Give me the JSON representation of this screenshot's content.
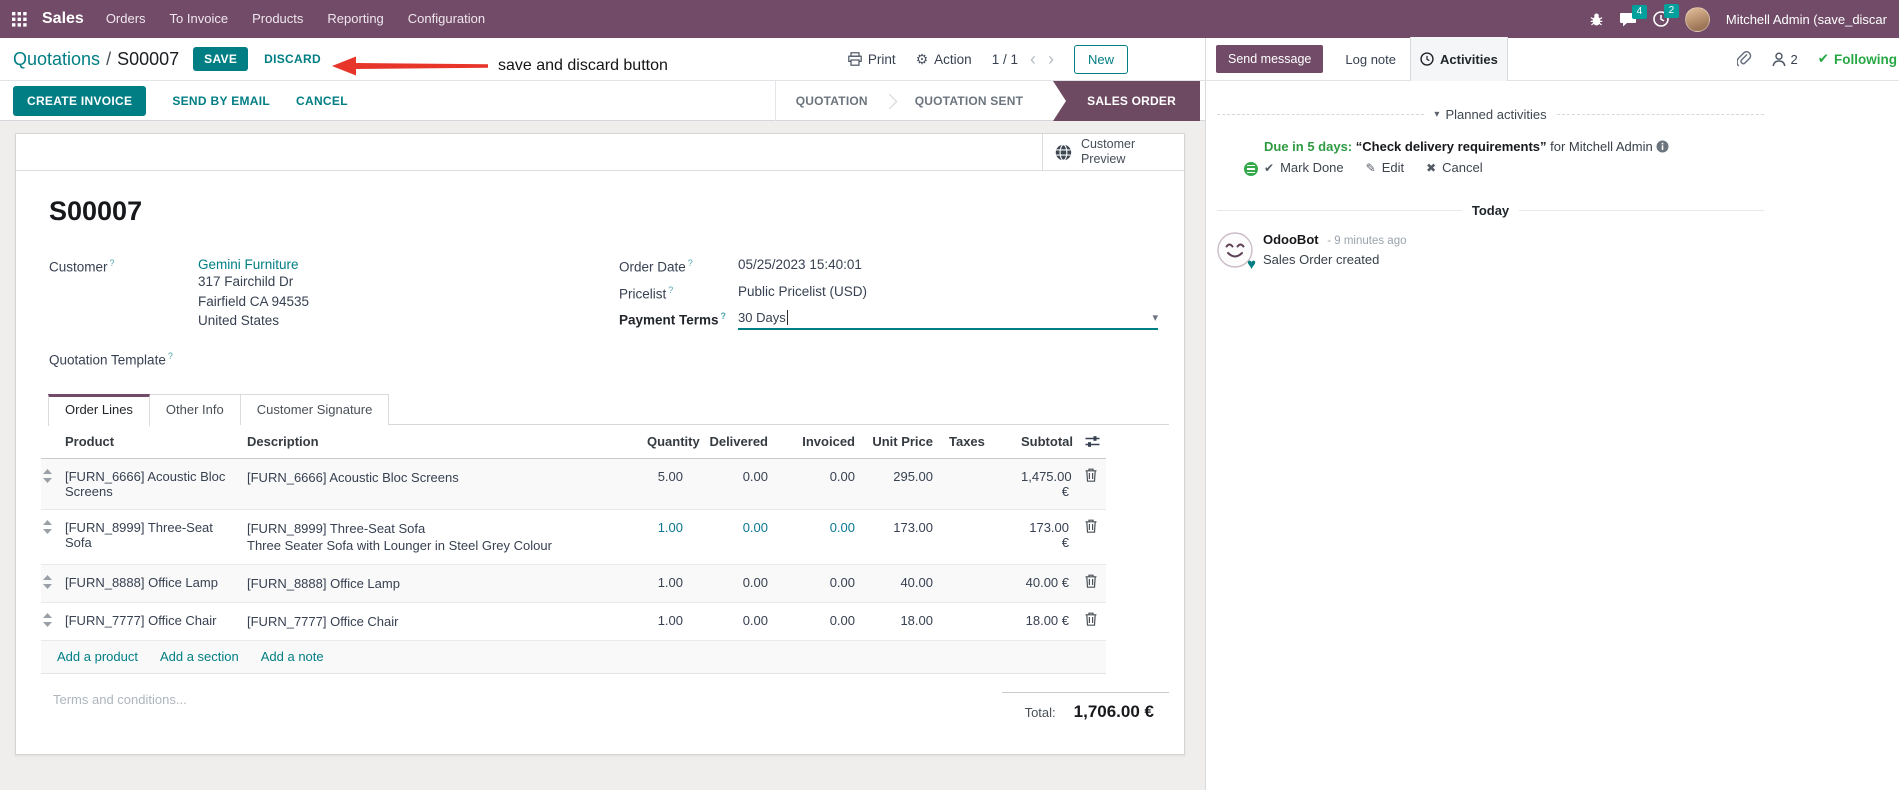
{
  "nav": {
    "app": "Sales",
    "menu": [
      "Orders",
      "To Invoice",
      "Products",
      "Reporting",
      "Configuration"
    ],
    "badge_messages": "4",
    "badge_activities": "2",
    "user": "Mitchell Admin (save_discar"
  },
  "breadcrumb": {
    "parent": "Quotations",
    "separator": "/",
    "current": "S00007",
    "save_label": "SAVE",
    "discard_label": "DISCARD"
  },
  "annotation": {
    "text": "save and discard button"
  },
  "toolbar": {
    "print_label": "Print",
    "action_label": "Action",
    "pager": "1 / 1",
    "new_label": "New"
  },
  "action_buttons": [
    "CREATE INVOICE",
    "SEND BY EMAIL",
    "CANCEL"
  ],
  "statusbar": {
    "steps": [
      "QUOTATION",
      "QUOTATION SENT",
      "SALES ORDER"
    ]
  },
  "form": {
    "reference": "S00007",
    "preview_label": "Customer Preview",
    "help_marker": "?",
    "customer": {
      "label": "Customer",
      "value": "Gemini Furniture",
      "address": [
        "317 Fairchild Dr",
        "Fairfield CA 94535",
        "United States"
      ]
    },
    "quotation_template": {
      "label": "Quotation Template"
    },
    "order_date": {
      "label": "Order Date",
      "value": "05/25/2023 15:40:01"
    },
    "pricelist": {
      "label": "Pricelist",
      "value": "Public Pricelist (USD)"
    },
    "payment_terms": {
      "label": "Payment Terms",
      "value": "30 Days"
    },
    "tabs": [
      "Order Lines",
      "Other Info",
      "Customer Signature"
    ],
    "table": {
      "headers": [
        "Product",
        "Description",
        "Quantity",
        "Delivered",
        "Invoiced",
        "Unit Price",
        "Taxes",
        "Subtotal"
      ],
      "rows": [
        {
          "product": "[FURN_6666] Acoustic Bloc Screens",
          "description": [
            "[FURN_6666] Acoustic Bloc Screens"
          ],
          "quantity": "5.00",
          "delivered": "0.00",
          "invoiced": "0.00",
          "unit_price": "295.00",
          "taxes": "",
          "subtotal": "1,475.00 €",
          "highlighted": false
        },
        {
          "product": "[FURN_8999] Three-Seat Sofa",
          "description": [
            "[FURN_8999] Three-Seat Sofa",
            "Three Seater Sofa with Lounger in Steel Grey Colour"
          ],
          "quantity": "1.00",
          "delivered": "0.00",
          "invoiced": "0.00",
          "unit_price": "173.00",
          "taxes": "",
          "subtotal": "173.00 €",
          "highlighted": true
        },
        {
          "product": "[FURN_8888] Office Lamp",
          "description": [
            "[FURN_8888] Office Lamp"
          ],
          "quantity": "1.00",
          "delivered": "0.00",
          "invoiced": "0.00",
          "unit_price": "40.00",
          "taxes": "",
          "subtotal": "40.00 €",
          "highlighted": false
        },
        {
          "product": "[FURN_7777] Office Chair",
          "description": [
            "[FURN_7777] Office Chair"
          ],
          "quantity": "1.00",
          "delivered": "0.00",
          "invoiced": "0.00",
          "unit_price": "18.00",
          "taxes": "",
          "subtotal": "18.00 €",
          "highlighted": false
        }
      ]
    },
    "add_links": [
      "Add a product",
      "Add a section",
      "Add a note"
    ],
    "terms_placeholder": "Terms and conditions...",
    "total": {
      "label": "Total:",
      "value": "1,706.00 €"
    }
  },
  "chatter": {
    "send_message": "Send message",
    "log_note": "Log note",
    "activities": "Activities",
    "followers_count": "2",
    "following": "Following",
    "planned_header": "Planned activities",
    "activity": {
      "due": "Due in 5 days:",
      "summary": "“Check delivery requirements”",
      "assignee": "for Mitchell Admin",
      "actions": [
        "Mark Done",
        "Edit",
        "Cancel"
      ]
    },
    "today": "Today",
    "message": {
      "author": "OdooBot",
      "time": "- 9 minutes ago",
      "body": "Sales Order created"
    }
  },
  "glyphs": {
    "prev": "‹",
    "next": "›",
    "caret_down": "▾",
    "section_caret": "▾",
    "check": "✔",
    "edit": "✎",
    "cancel": "✖",
    "gear": "⚙",
    "heart": "♥"
  },
  "colors": {
    "brand": "#714B67",
    "primary": "#017E84",
    "success": "#28a745",
    "badge": "#00A09D",
    "edited_cell": "#0c7792",
    "annotation_arrow": "#E8352A"
  }
}
